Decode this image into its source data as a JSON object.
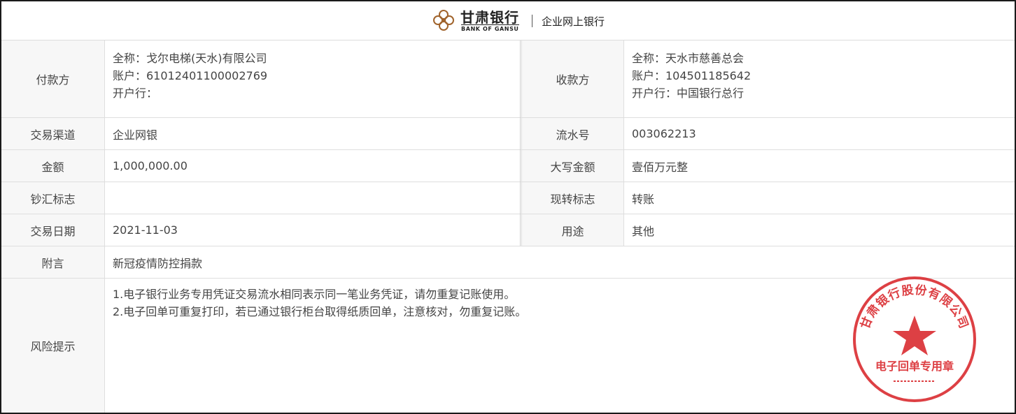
{
  "header": {
    "bank_name_cn": "甘肃银行",
    "bank_name_en": "BANK OF GANSU",
    "subtitle": "企业网上银行"
  },
  "payer": {
    "label": "付款方",
    "full_name": "全称：戈尔电梯(天水)有限公司",
    "account": "账户：61012401100002769",
    "bank": "开户行："
  },
  "payee": {
    "label": "收款方",
    "full_name": "全称：天水市慈善总会",
    "account": "账户：104501185642",
    "bank": "开户行：中国银行总行"
  },
  "rows": {
    "channel_label": "交易渠道",
    "channel_value": "企业网银",
    "serial_label": "流水号",
    "serial_value": "003062213",
    "amount_label": "金额",
    "amount_value": "1,000,000.00",
    "amount_upper_label": "大写金额",
    "amount_upper_value": "壹佰万元整",
    "currency_label": "钞汇标志",
    "currency_value": "",
    "transfer_label": "现转标志",
    "transfer_value": "转账",
    "date_label": "交易日期",
    "date_value": "2021-11-03",
    "purpose_label": "用途",
    "purpose_value": "其他",
    "memo_label": "附言",
    "memo_value": "新冠疫情防控捐款",
    "risk_label": "风险提示",
    "risk_line1": "1.电子银行业务专用凭证交易流水相同表示同一笔业务凭证，请勿重复记账使用。",
    "risk_line2": "2.电子回单可重复打印，若已通过银行柜台取得纸质回单，注意核对，勿重复记账。"
  },
  "seal": {
    "text_top": "甘肃银行股份有限公司",
    "text_bottom": "电子回单专用章",
    "color": "#d9262b"
  },
  "colors": {
    "label_bg": "#f7f7f7",
    "grid": "#dedede",
    "text": "#444444"
  }
}
